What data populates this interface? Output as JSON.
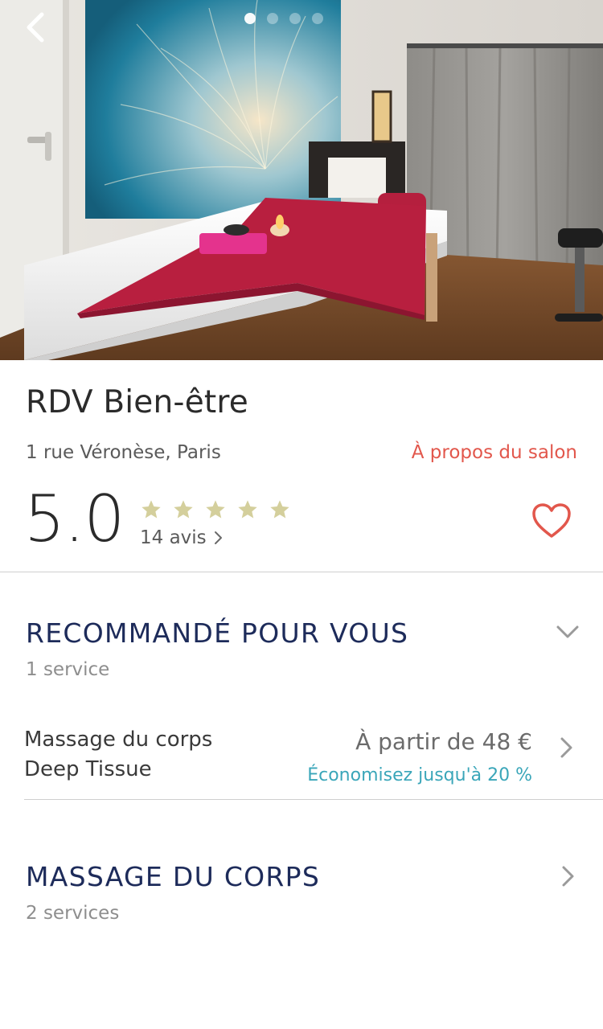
{
  "salon": {
    "name": "RDV Bien-être",
    "address": "1 rue Véronèse, Paris",
    "about_link": "À propos du salon",
    "rating": "5.0",
    "stars": 5,
    "reviews": "14 avis"
  },
  "gallery": {
    "pages": 4,
    "active": 0
  },
  "sections": [
    {
      "title": "RECOMMANDÉ POUR VOUS",
      "subtitle": "1 service",
      "chevron": "chevron-down-icon",
      "services": [
        {
          "name_line1": "Massage du corps",
          "name_line2": "Deep Tissue",
          "price": "À partir de 48 €",
          "discount": "Économisez jusqu'à 20 %"
        }
      ]
    },
    {
      "title": "MASSAGE DU CORPS",
      "subtitle": "2 services",
      "chevron": "chevron-right-icon"
    }
  ],
  "colors": {
    "accent_red": "#e2574c",
    "navy": "#1d2b5a",
    "teal": "#3aa6b9",
    "star": "#d4cf9c"
  }
}
